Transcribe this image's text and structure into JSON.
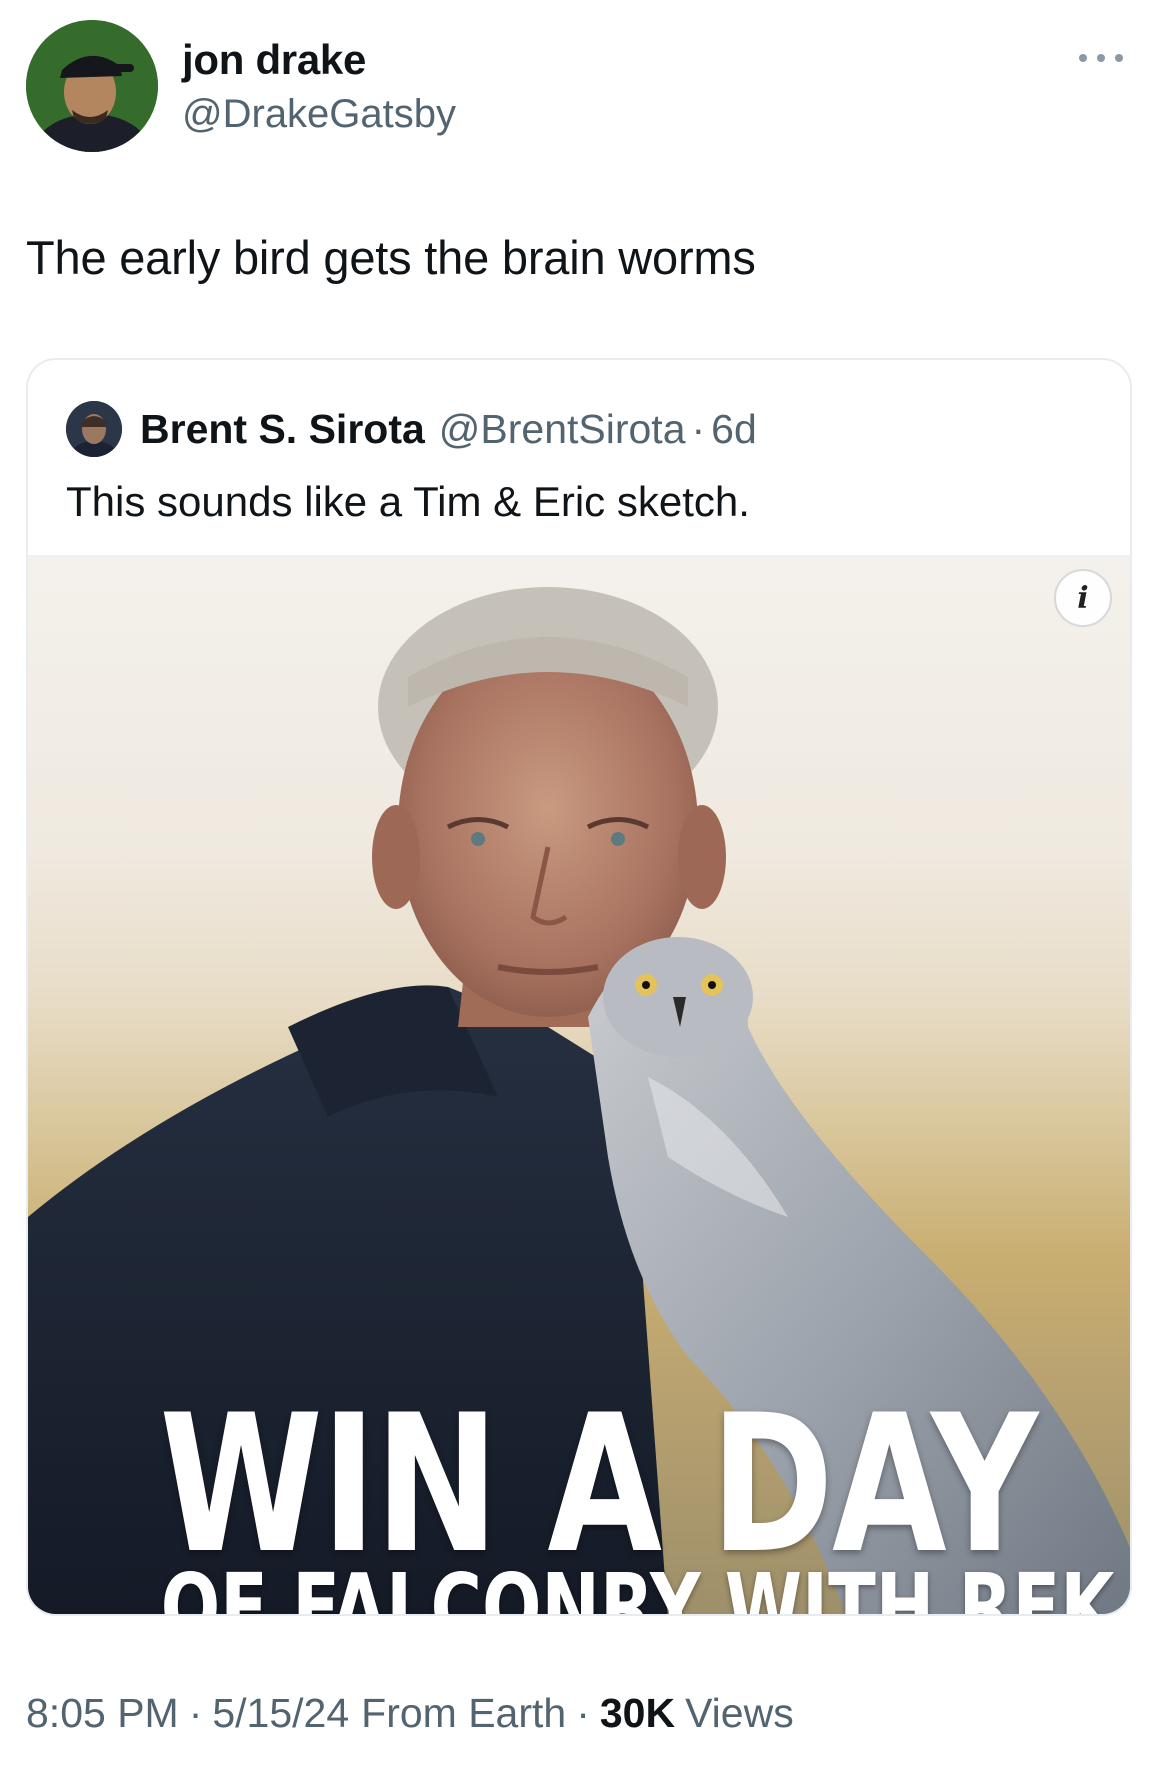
{
  "tweet": {
    "author": {
      "name": "jon drake",
      "handle": "@DrakeGatsby"
    },
    "text": "The early bird gets the brain worms",
    "more_icon": "more-horizontal-icon"
  },
  "quoted_tweet": {
    "author": {
      "name": "Brent S. Sirota",
      "handle": "@BrentSirota"
    },
    "separator": "·",
    "time": "6d",
    "text": "This sounds like a Tim & Eric sketch.",
    "media": {
      "info_badge": "i",
      "headline": "WIN A DAY",
      "subheadline": "OF FALCONRY WITH RFK JR."
    }
  },
  "meta": {
    "time": "8:05 PM",
    "sep": "·",
    "date": "5/15/24",
    "source": "From Earth",
    "views_count": "30K",
    "views_label": "Views"
  },
  "colors": {
    "text": "#0f1419",
    "secondary": "#536471",
    "border": "#e6ecf0"
  }
}
